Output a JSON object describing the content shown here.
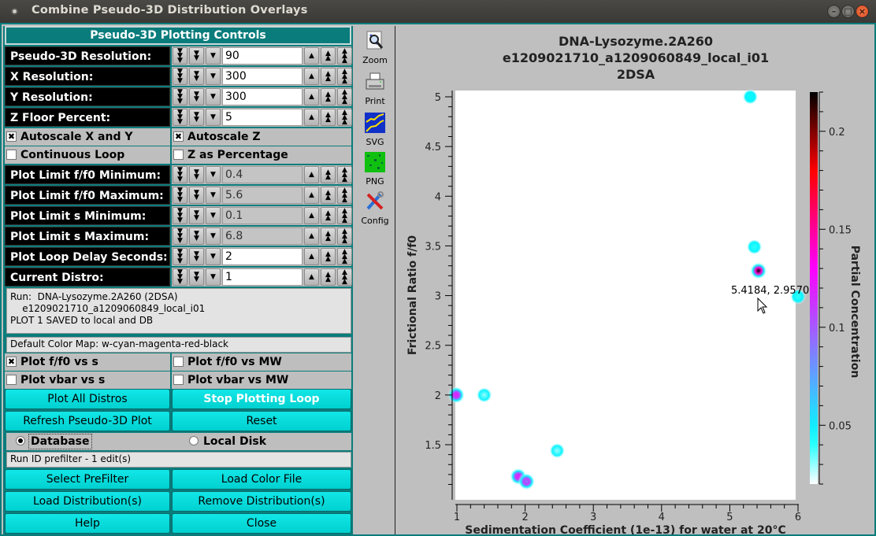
{
  "window": {
    "title": "Combine Pseudo-3D Distribution Overlays",
    "controls": [
      "minimize",
      "maximize",
      "close"
    ]
  },
  "panel": {
    "header": "Pseudo-3D Plotting Controls",
    "counters": [
      {
        "label": "Pseudo-3D Resolution:",
        "value": "90",
        "enabled": true
      },
      {
        "label": "X Resolution:",
        "value": "300",
        "enabled": true
      },
      {
        "label": "Y Resolution:",
        "value": "300",
        "enabled": true
      },
      {
        "label": "Z Floor Percent:",
        "value": "5",
        "enabled": true
      }
    ],
    "checks1": [
      {
        "label": "Autoscale X and Y",
        "checked": true
      },
      {
        "label": "Autoscale Z",
        "checked": true
      },
      {
        "label": "Continuous Loop",
        "checked": false
      },
      {
        "label": "Z as Percentage",
        "checked": false
      }
    ],
    "counters2": [
      {
        "label": "Plot Limit f/f0 Minimum:",
        "value": "0.4",
        "enabled": false
      },
      {
        "label": "Plot Limit f/f0 Maximum:",
        "value": "5.6",
        "enabled": false
      },
      {
        "label": "Plot Limit s Minimum:",
        "value": "0.1",
        "enabled": false
      },
      {
        "label": "Plot Limit s Maximum:",
        "value": "6.8",
        "enabled": false
      },
      {
        "label": "Plot Loop Delay Seconds:",
        "value": "2",
        "enabled": true
      },
      {
        "label": "Current Distro:",
        "value": "1",
        "enabled": true
      }
    ],
    "status_text": "Run:  DNA-Lysozyme.2A260 (2DSA)\n    e1209021710_a1209060849_local_i01\nPLOT 1 SAVED to local and DB",
    "color_map": "Default Color Map: w-cyan-magenta-red-black",
    "checks2": [
      {
        "label": "Plot f/f0 vs s",
        "checked": true
      },
      {
        "label": "Plot f/f0 vs MW",
        "checked": false
      },
      {
        "label": "Plot vbar vs s",
        "checked": false
      },
      {
        "label": "Plot vbar vs MW",
        "checked": false
      }
    ],
    "buttons1": {
      "plot_all": "Plot All Distros",
      "stop_loop": "Stop Plotting Loop",
      "refresh": "Refresh Pseudo-3D Plot",
      "reset": "Reset"
    },
    "source": {
      "database": "Database",
      "local_disk": "Local Disk",
      "selected": "database"
    },
    "prefilter_status": "Run ID prefilter - 1 edit(s)",
    "buttons2": {
      "select_prefilter": "Select PreFilter",
      "load_color": "Load Color File",
      "load_distros": "Load Distribution(s)",
      "remove_distros": "Remove Distribution(s)",
      "help": "Help",
      "close": "Close"
    }
  },
  "toolbar": [
    {
      "label": "Zoom",
      "icon": "zoom-icon"
    },
    {
      "label": "Print",
      "icon": "printer-icon"
    },
    {
      "label": "SVG",
      "icon": "svg-icon"
    },
    {
      "label": "PNG",
      "icon": "png-icon"
    },
    {
      "label": "Config",
      "icon": "config-icon"
    }
  ],
  "cursor_readout": "5.4184, 2.9570",
  "chart_data": {
    "type": "heatmap",
    "title": [
      "DNA-Lysozyme.2A260",
      "e1209021710_a1209060849_local_i01",
      "2DSA"
    ],
    "xlabel": "Sedimentation Coefficient (1e-13) for water at 20°C",
    "ylabel": "Frictional Ratio f/f0",
    "zlabel": "Partial Concentration",
    "xlim": [
      0.97,
      6.08
    ],
    "ylim": [
      1.07,
      5.08
    ],
    "xticks": [
      1,
      2,
      3,
      4,
      5,
      6
    ],
    "xtick_labels": [
      "1",
      "2",
      "3",
      "4",
      "5",
      "6"
    ],
    "yticks": [
      1.5,
      2,
      2.5,
      3,
      3.5,
      4,
      4.5,
      5
    ],
    "ytick_labels": [
      "1.5",
      "2",
      "2.5",
      "3",
      "3.5",
      "4",
      "4.5",
      "5"
    ],
    "zlim": [
      0.02,
      0.22
    ],
    "zticks": [
      0.05,
      0.1,
      0.15,
      0.2
    ],
    "ztick_labels": [
      "0.05",
      "0.1",
      "0.15",
      "0.2"
    ],
    "colormap": [
      "#ffffff",
      "#00ffff",
      "#ff00ff",
      "#ff0000",
      "#000000"
    ],
    "points": [
      {
        "s": 5.3,
        "ff0": 5.0,
        "c": 0.045
      },
      {
        "s": 5.36,
        "ff0": 3.49,
        "c": 0.04
      },
      {
        "s": 5.42,
        "ff0": 3.25,
        "c": 0.22
      },
      {
        "s": 6.0,
        "ff0": 2.99,
        "c": 0.04
      },
      {
        "s": 0.99,
        "ff0": 2.0,
        "c": 0.12
      },
      {
        "s": 1.4,
        "ff0": 2.0,
        "c": 0.03
      },
      {
        "s": 1.9,
        "ff0": 1.18,
        "c": 0.12
      },
      {
        "s": 2.02,
        "ff0": 1.13,
        "c": 0.09
      },
      {
        "s": 2.47,
        "ff0": 1.44,
        "c": 0.03
      }
    ]
  }
}
